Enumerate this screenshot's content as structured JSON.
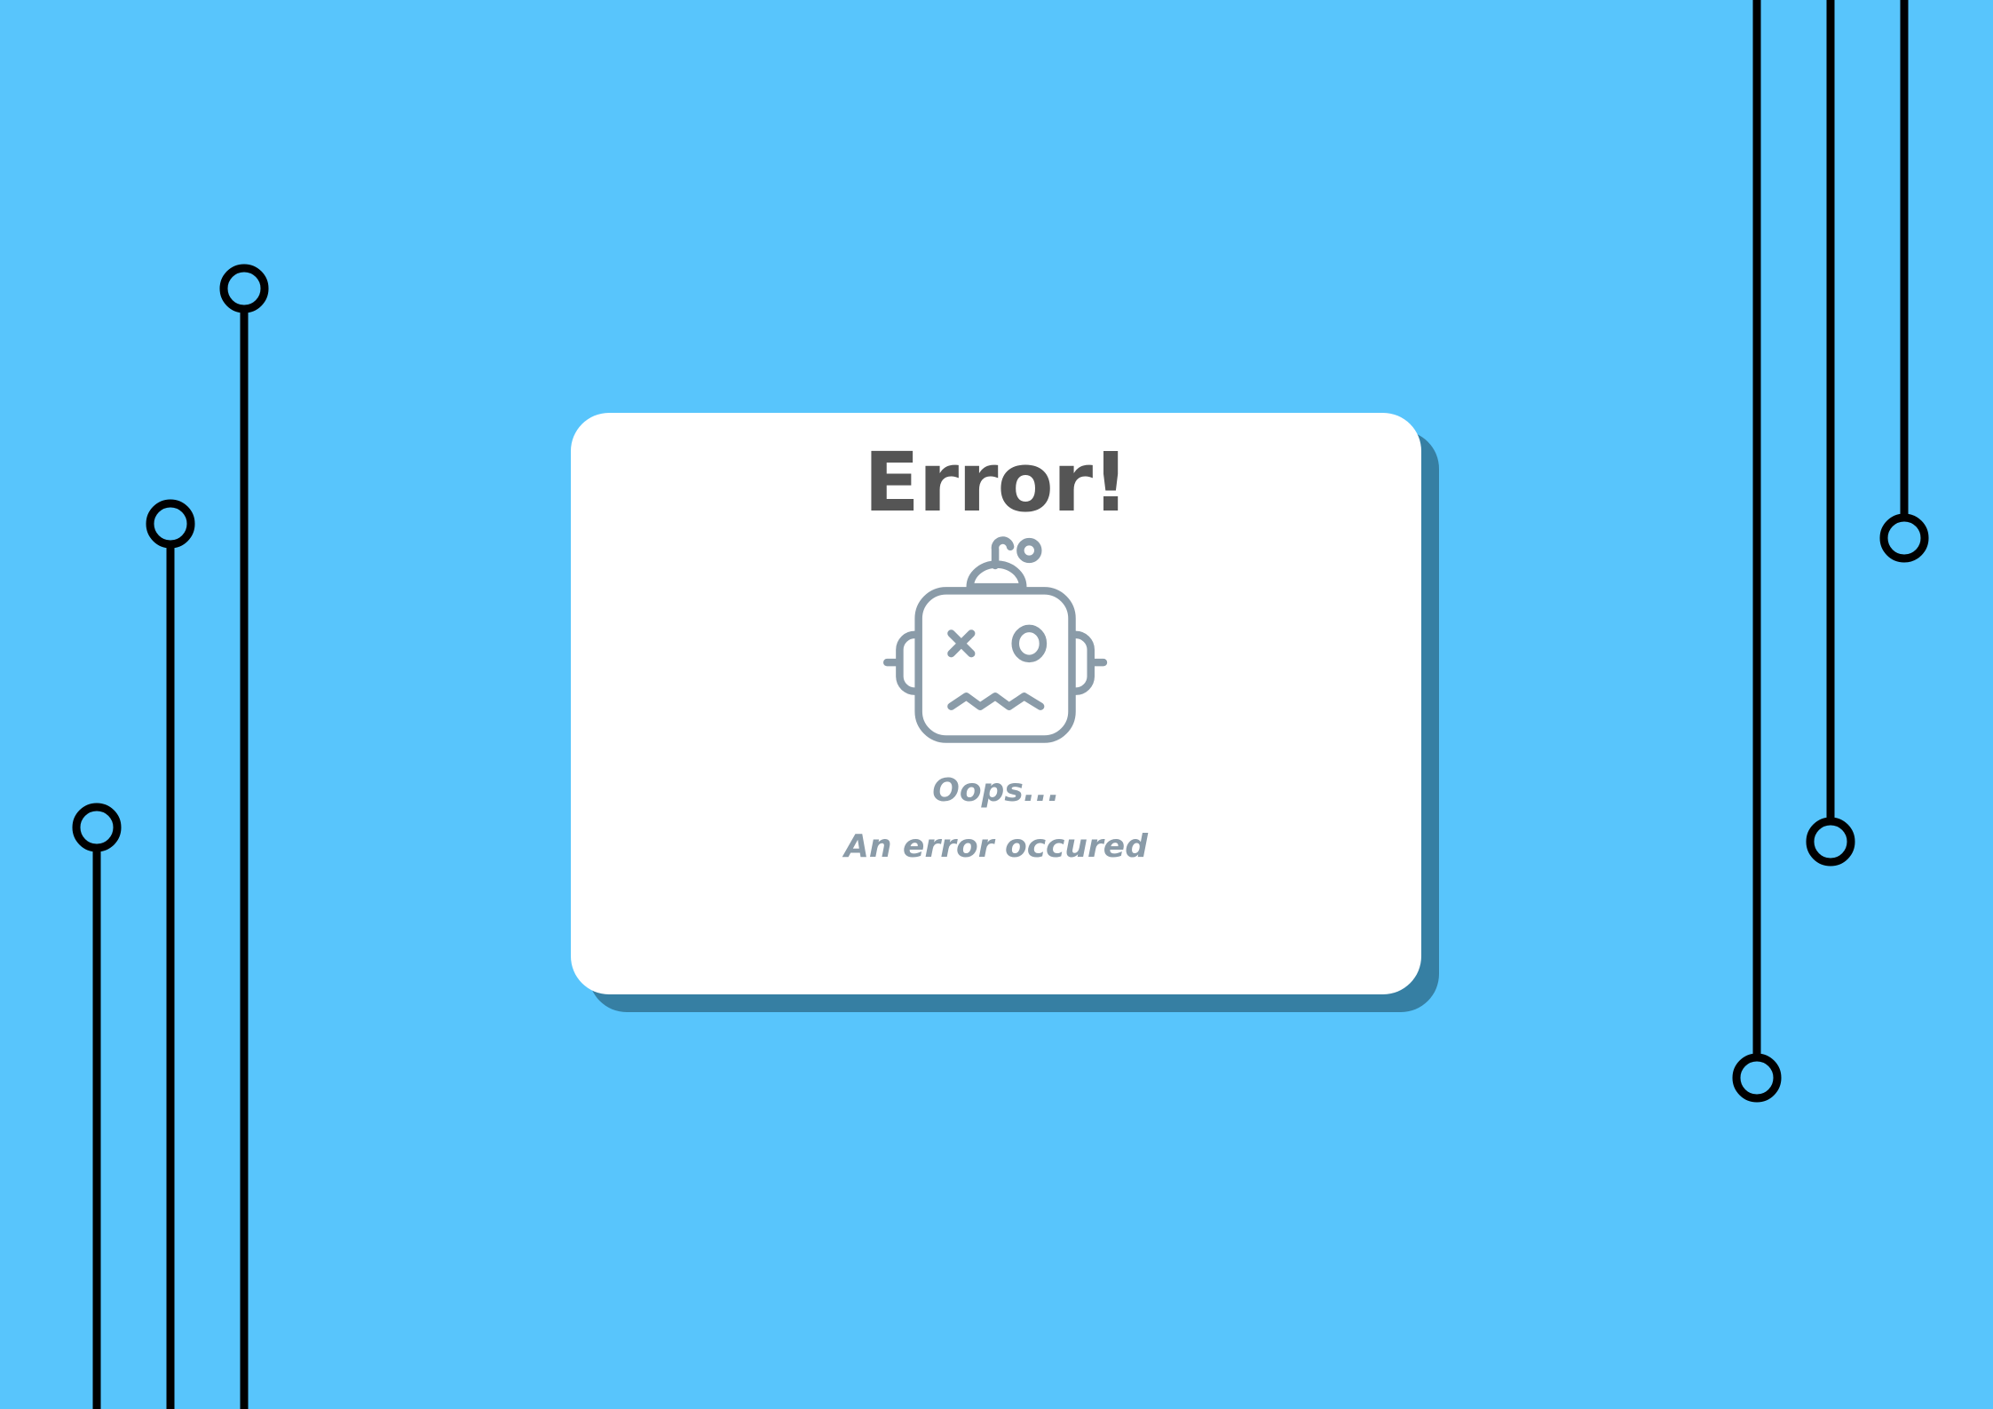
{
  "colors": {
    "background": "#58c5fc",
    "card_shadow": "#367fa3",
    "title": "#555555",
    "message": "#8a9ba8",
    "circuit_lines": "#000000"
  },
  "error_card": {
    "title": "Error!",
    "icon": "broken-robot-icon",
    "subtitle": "Oops...",
    "message": "An error occured"
  }
}
